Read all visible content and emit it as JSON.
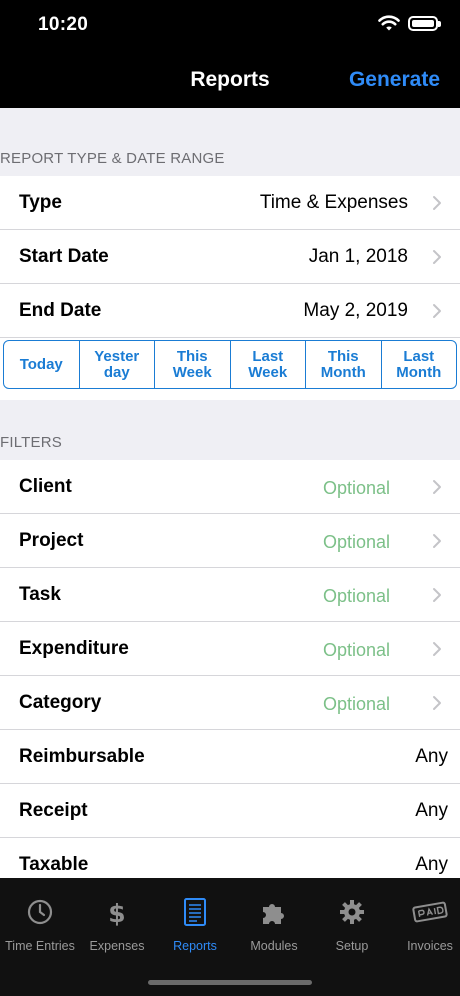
{
  "status": {
    "time": "10:20"
  },
  "nav": {
    "title": "Reports",
    "generate": "Generate"
  },
  "report_section": {
    "header": "REPORT TYPE & DATE RANGE",
    "rows": [
      {
        "label": "Type",
        "value": "Time & Expenses"
      },
      {
        "label": "Start Date",
        "value": "Jan 1, 2018"
      },
      {
        "label": "End Date",
        "value": "May 2, 2019"
      }
    ],
    "quick_ranges": [
      "Today",
      "Yester\nday",
      "This\nWeek",
      "Last\nWeek",
      "This\nMonth",
      "Last\nMonth"
    ]
  },
  "filters_section": {
    "header": "FILTERS",
    "rows": [
      {
        "label": "Client",
        "value": "Optional"
      },
      {
        "label": "Project",
        "value": "Optional"
      },
      {
        "label": "Task",
        "value": "Optional"
      },
      {
        "label": "Expenditure",
        "value": "Optional"
      },
      {
        "label": "Category",
        "value": "Optional"
      },
      {
        "label": "Reimbursable",
        "value": "Any"
      },
      {
        "label": "Receipt",
        "value": "Any"
      },
      {
        "label": "Taxable",
        "value": "Any"
      }
    ]
  },
  "tabbar": {
    "tabs": [
      {
        "label": "Time Entries",
        "icon": "clock-icon"
      },
      {
        "label": "Expenses",
        "icon": "dollar-icon"
      },
      {
        "label": "Reports",
        "icon": "report-icon",
        "active": true
      },
      {
        "label": "Modules",
        "icon": "puzzle-icon"
      },
      {
        "label": "Setup",
        "icon": "gear-icon"
      },
      {
        "label": "Invoices",
        "icon": "paid-stamp-icon"
      }
    ]
  },
  "colors": {
    "accent": "#2f8bf7",
    "quick_button": "#1a7cd4",
    "optional_text": "#7cc088"
  }
}
